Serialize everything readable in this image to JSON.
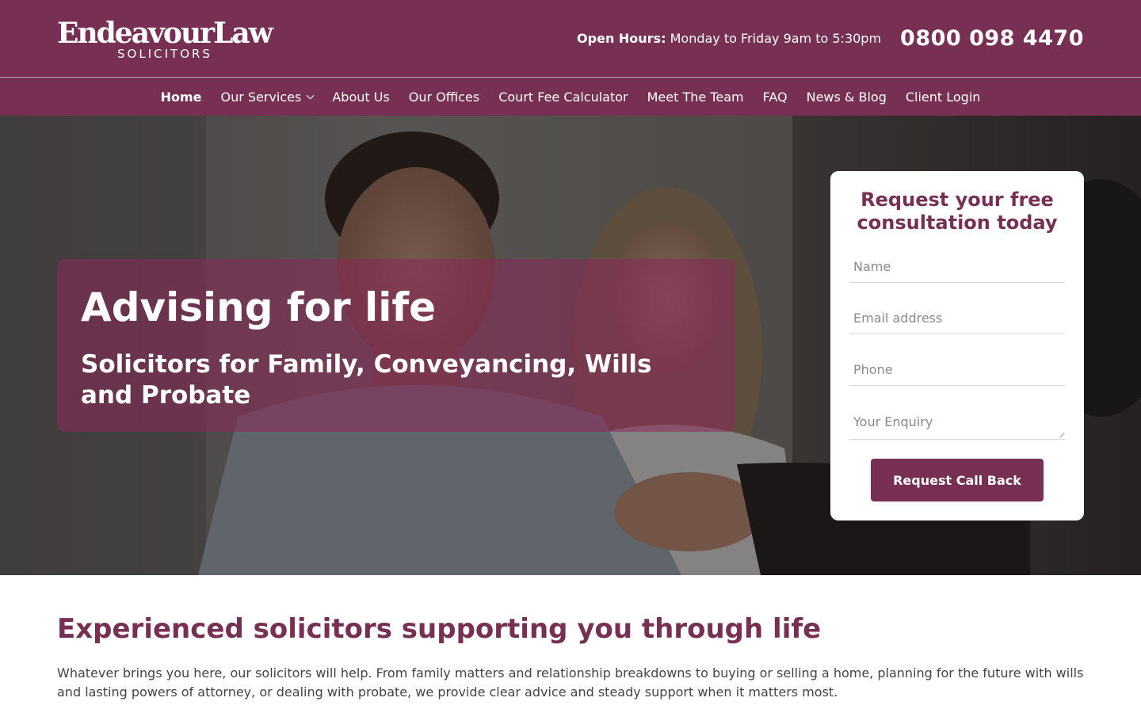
{
  "header": {
    "logo_main": "EndeavourLaw",
    "logo_sub": "SOLICITORS",
    "hours_label": "Open Hours:",
    "hours_value": "Monday to Friday 9am to 5:30pm",
    "phone": "0800 098 4470"
  },
  "nav": {
    "items": [
      {
        "label": "Home"
      },
      {
        "label": "Our Services"
      },
      {
        "label": "About Us"
      },
      {
        "label": "Our Offices"
      },
      {
        "label": "Court Fee Calculator"
      },
      {
        "label": "Meet The Team"
      },
      {
        "label": "FAQ"
      },
      {
        "label": "News & Blog"
      },
      {
        "label": "Client Login"
      }
    ]
  },
  "hero": {
    "title": "Advising for life",
    "subtitle": "Solicitors for Family, Conveyancing, Wills and Probate"
  },
  "form": {
    "title": "Request your free consultation today",
    "name_placeholder": "Name",
    "email_placeholder": "Email address",
    "phone_placeholder": "Phone",
    "enquiry_placeholder": "Your Enquiry",
    "submit_label": "Request Call Back"
  },
  "intro": {
    "title": "Experienced solicitors supporting you through life",
    "text": "Whatever brings you here, our solicitors will help. From family matters and relationship breakdowns to buying or selling a home, planning for the future with wills and lasting powers of attorney, or dealing with probate, we provide clear advice and steady support when it matters most."
  },
  "colors": {
    "brand": "#772f54",
    "panel": "#8c285a"
  }
}
